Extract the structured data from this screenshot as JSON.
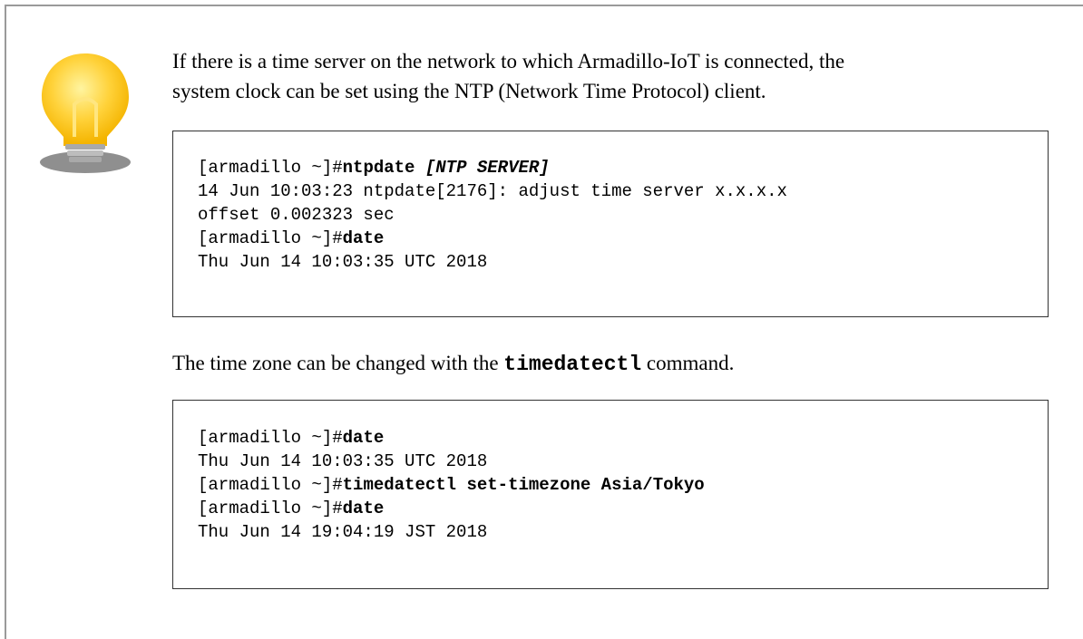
{
  "tip": {
    "icon": "lightbulb-icon",
    "paragraph1": {
      "line1": "If there is a time server on the network to which Armadillo-IoT is connected, the",
      "line2": "system clock can be set using the NTP (Network Time Protocol) client."
    },
    "code1": {
      "line1_prompt": "[armadillo ~]#",
      "line1_cmd": "ntpdate ",
      "line1_arg": "[NTP SERVER]",
      "line2": "14 Jun 10:03:23 ntpdate[2176]: adjust time server x.x.x.x",
      "line3": "offset 0.002323 sec",
      "line4_prompt": "[armadillo ~]#",
      "line4_cmd": "date",
      "line5": "Thu Jun 14 10:03:35 UTC 2018"
    },
    "paragraph2": {
      "before": "The time zone can be changed with the ",
      "command": "timedatectl",
      "after": " command."
    },
    "code2": {
      "line1_prompt": "[armadillo ~]#",
      "line1_cmd": "date",
      "line2": "Thu Jun 14 10:03:35 UTC 2018",
      "line3_prompt": "[armadillo ~]#",
      "line3_cmd": "timedatectl set-timezone Asia/Tokyo",
      "line4_prompt": "[armadillo ~]#",
      "line4_cmd": "date",
      "line5": "Thu Jun 14 19:04:19 JST 2018"
    }
  }
}
